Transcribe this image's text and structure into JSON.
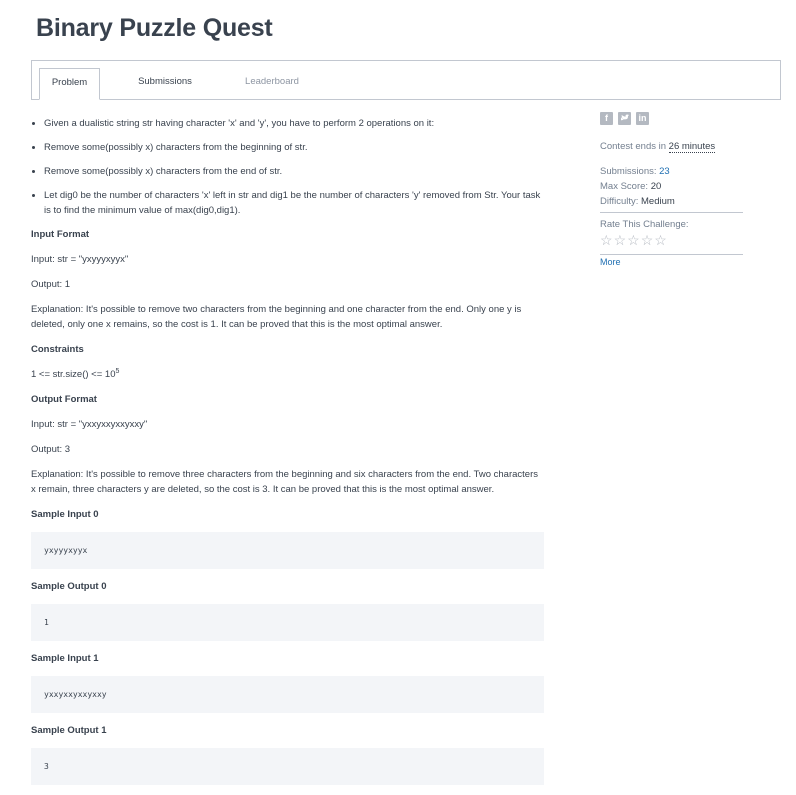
{
  "title": "Binary Puzzle Quest",
  "tabs": {
    "problem": "Problem",
    "submissions": "Submissions",
    "leaderboard": "Leaderboard"
  },
  "bullets": [
    "Given a dualistic string str having character 'x' and 'y', you have to perform 2 operations on it:",
    "Remove some(possibly x) characters from the beginning of str.",
    "Remove some(possibly x) characters from the end of str.",
    "Let dig0 be the number of characters 'x' left in str and dig1 be the number of characters 'y' removed from Str. Your task is to find the minimum value of max(dig0,dig1)."
  ],
  "input_format": {
    "heading": "Input Format",
    "input": "Input: str = \"yxyyyxyyx\"",
    "output": "Output: 1",
    "explanation": "Explanation: It's possible to remove two characters from the beginning and one character from the end. Only one y is deleted, only one x remains, so the cost is 1. It can be proved that this is the most optimal answer."
  },
  "constraints": {
    "heading": "Constraints",
    "text": "1 <= str.size() <= 10",
    "exponent": "5"
  },
  "output_format": {
    "heading": "Output Format",
    "input": "Input: str = \"yxxyxxyxxyxxy\"",
    "output": "Output: 3",
    "explanation": "Explanation: It's possible to remove three characters from the beginning and six characters from the end. Two characters x remain, three characters y are deleted, so the cost is 3. It can be proved that this is the most optimal answer."
  },
  "samples": [
    {
      "heading": "Sample Input 0",
      "value": "yxyyyxyyx"
    },
    {
      "heading": "Sample Output 0",
      "value": "1"
    },
    {
      "heading": "Sample Input 1",
      "value": "yxxyxxyxxyxxy"
    },
    {
      "heading": "Sample Output 1",
      "value": "3"
    }
  ],
  "sidebar": {
    "social_icons": [
      "facebook-icon",
      "twitter-icon",
      "linkedin-icon"
    ],
    "contest_prefix": "Contest ends in ",
    "contest_time": "26 minutes",
    "submissions_label": "Submissions: ",
    "submissions_value": "23",
    "max_score_label": "Max Score: ",
    "max_score_value": "20",
    "difficulty_label": "Difficulty: ",
    "difficulty_value": "Medium",
    "rate_label": "Rate This Challenge:",
    "rating_stars_filled": 0,
    "rating_stars_total": 5,
    "more": "More"
  },
  "colors": {
    "text": "#39424e",
    "muted": "#737f8f",
    "link": "#1f6fb2",
    "code_bg": "#f3f5f8",
    "border": "#c2c7d0"
  }
}
